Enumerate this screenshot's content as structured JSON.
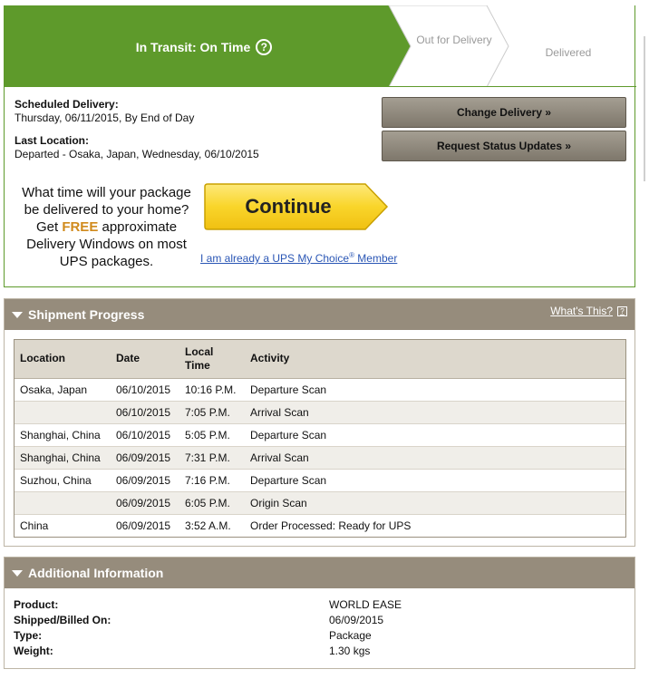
{
  "status": {
    "current": "In Transit: On Time",
    "help_glyph": "?",
    "next_step": "Out for Delivery",
    "final_step": "Delivered",
    "colors": {
      "active": "#5e9a2b",
      "inactive": "#ffffff"
    }
  },
  "delivery": {
    "scheduled_label": "Scheduled Delivery:",
    "scheduled_value": "Thursday, 06/11/2015, By End of Day",
    "last_location_label": "Last Location:",
    "last_location_value": "Departed - Osaka, Japan, Wednesday, 06/10/2015"
  },
  "buttons": {
    "change_delivery": "Change Delivery »",
    "request_updates": "Request Status Updates »"
  },
  "promo": {
    "line1": "What time will your package be delivered to your home? Get ",
    "free": "FREE",
    "line2": " approximate Delivery Windows on most UPS packages.",
    "continue_label": "Continue",
    "member_link_pre": "I am already a UPS My Choice",
    "member_link_reg": "®",
    "member_link_post": " Member"
  },
  "shipment_progress": {
    "title": "Shipment Progress",
    "whats_this": "What's This?",
    "columns": [
      "Location",
      "Date",
      "Local Time",
      "Activity"
    ],
    "rows": [
      {
        "location": "Osaka, Japan",
        "date": "06/10/2015",
        "time": "10:16 P.M.",
        "activity": "Departure Scan"
      },
      {
        "location": "",
        "date": "06/10/2015",
        "time": "7:05 P.M.",
        "activity": "Arrival Scan"
      },
      {
        "location": "Shanghai, China",
        "date": "06/10/2015",
        "time": "5:05 P.M.",
        "activity": "Departure Scan"
      },
      {
        "location": "Shanghai, China",
        "date": "06/09/2015",
        "time": "7:31 P.M.",
        "activity": "Arrival Scan"
      },
      {
        "location": "Suzhou, China",
        "date": "06/09/2015",
        "time": "7:16 P.M.",
        "activity": "Departure Scan"
      },
      {
        "location": "",
        "date": "06/09/2015",
        "time": "6:05 P.M.",
        "activity": "Origin Scan"
      },
      {
        "location": "China",
        "date": "06/09/2015",
        "time": "3:52 A.M.",
        "activity": "Order Processed: Ready for UPS"
      }
    ]
  },
  "additional_information": {
    "title": "Additional Information",
    "items": [
      {
        "label": "Product:",
        "value": "WORLD EASE"
      },
      {
        "label": "Shipped/Billed On:",
        "value": "06/09/2015"
      },
      {
        "label": "Type:",
        "value": "Package"
      },
      {
        "label": "Weight:",
        "value": "1.30 kgs"
      }
    ]
  }
}
